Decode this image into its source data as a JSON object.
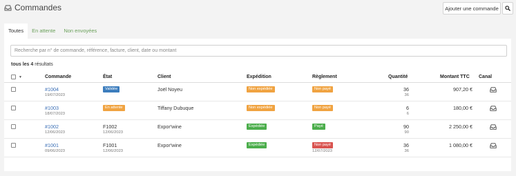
{
  "header": {
    "title": "Commandes",
    "add_label": "Ajouter une commande"
  },
  "tabs": [
    {
      "label": "Toutes"
    },
    {
      "label": "En attente"
    },
    {
      "label": "Non envoyées"
    }
  ],
  "search": {
    "placeholder": "Recherche par n° de commande, référence, facture, client, date ou montant"
  },
  "results": {
    "prefix": "tous les 4",
    "suffix": "résultats"
  },
  "columns": {
    "commande": "Commande",
    "etat": "État",
    "client": "Client",
    "expedition": "Expédition",
    "reglement": "Règlement",
    "quantite": "Quantité",
    "montant": "Montant TTC",
    "canal": "Canal"
  },
  "colors": {
    "blue": "#3c7dbd",
    "orange": "#f0a341",
    "green": "#4cae4c",
    "red": "#d9534f",
    "link": "#3b6fb6"
  },
  "orders": [
    {
      "number": "#1004",
      "date": "19/07/2023",
      "etat_badge": "Validée",
      "etat_color": "blue",
      "etat_text": "",
      "etat_date": "",
      "client": "Joël Noyeu",
      "expedition": "Non expédiée",
      "expedition_color": "orange",
      "reglement": "Non payé",
      "reglement_color": "orange",
      "reglement_date": "",
      "qty": "36",
      "qty_sub": "36",
      "montant": "907,20 €",
      "canal_icon": "inbox-icon"
    },
    {
      "number": "#1003",
      "date": "18/07/2023",
      "etat_badge": "En attente",
      "etat_color": "orange",
      "etat_text": "",
      "etat_date": "",
      "client": "Tiffany Dubuque",
      "expedition": "Non expédiée",
      "expedition_color": "orange",
      "reglement": "Non payé",
      "reglement_color": "orange",
      "reglement_date": "",
      "qty": "6",
      "qty_sub": "6",
      "montant": "180,00 €",
      "canal_icon": "inbox-icon"
    },
    {
      "number": "#1002",
      "date": "12/06/2023",
      "etat_badge": "",
      "etat_color": "",
      "etat_text": "F1002",
      "etat_date": "12/06/2023",
      "client": "Expor'wine",
      "expedition": "Expédiée",
      "expedition_color": "green",
      "reglement": "Payé",
      "reglement_color": "green",
      "reglement_date": "",
      "qty": "90",
      "qty_sub": "90",
      "montant": "2 250,00 €",
      "canal_icon": "inbox-icon"
    },
    {
      "number": "#1001",
      "date": "09/06/2023",
      "etat_badge": "",
      "etat_color": "",
      "etat_text": "F1001",
      "etat_date": "12/06/2023",
      "client": "Expor'wine",
      "expedition": "Expédiée",
      "expedition_color": "green",
      "reglement": "Non payé",
      "reglement_color": "red",
      "reglement_date": "12/07/2023",
      "qty": "36",
      "qty_sub": "36",
      "montant": "1 080,00 €",
      "canal_icon": "inbox-icon"
    }
  ]
}
